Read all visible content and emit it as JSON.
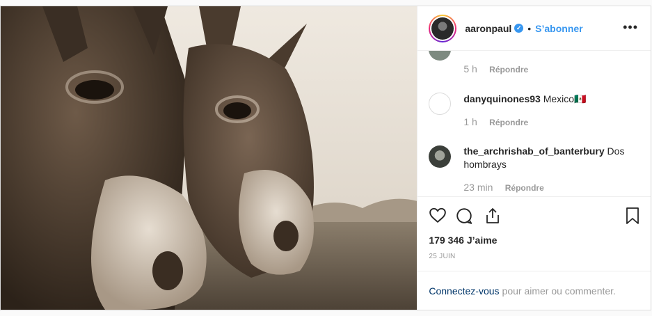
{
  "post": {
    "author": "aaronpaul",
    "separator": "•",
    "follow_label": "S’abonner",
    "more_label": "•••"
  },
  "comments": [
    {
      "time": "5 h",
      "reply": "Répondre"
    },
    {
      "user": "danyquinones93",
      "text": "Mexico🇲🇽",
      "time": "1 h",
      "reply": "Répondre"
    },
    {
      "user": "the_archrishab_of_banterbury",
      "text": "Dos hombrays",
      "time": "23 min",
      "reply": "Répondre"
    }
  ],
  "stats": {
    "likes": "179 346 J’aime",
    "date": "25 JUIN"
  },
  "login": {
    "link": "Connectez-vous",
    "text": "pour aimer ou commenter."
  },
  "colors": {
    "accent": "#3897f0",
    "link": "#003569",
    "muted": "#999999"
  }
}
